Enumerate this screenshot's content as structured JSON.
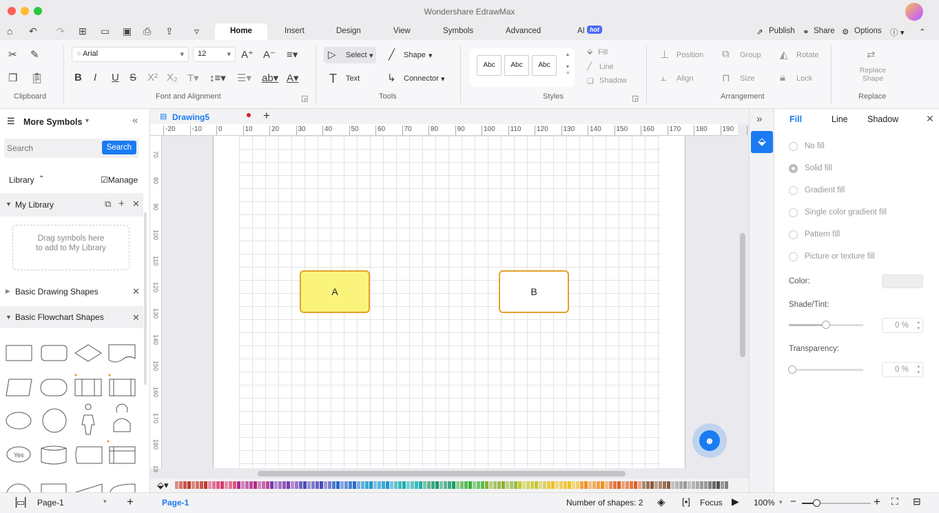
{
  "app": {
    "title": "Wondershare EdrawMax"
  },
  "menu": {
    "tabs": [
      "Home",
      "Insert",
      "Design",
      "View",
      "Symbols",
      "Advanced",
      "AI"
    ],
    "ai_badge": "hot",
    "publish": "Publish",
    "share": "Share",
    "options": "Options"
  },
  "ribbon": {
    "font_name": "Arial",
    "font_size": "12",
    "select": "Select",
    "shape": "Shape",
    "text": "Text",
    "connector": "Connector",
    "style_samples": [
      "Abc",
      "Abc",
      "Abc"
    ],
    "fill": "Fill",
    "line": "Line",
    "shadow": "Shadow",
    "position": "Position",
    "group": "Group",
    "rotate": "Rotate",
    "align": "Align",
    "size": "Size",
    "lock": "Lock",
    "replace_shape": "Replace Shape",
    "groups": [
      "Clipboard",
      "Font and Alignment",
      "Tools",
      "Styles",
      "Arrangement",
      "Replace"
    ]
  },
  "left_panel": {
    "title": "More Symbols",
    "search_placeholder": "Search",
    "search_button": "Search",
    "library_label": "Library",
    "manage": "Manage",
    "my_library": "My Library",
    "drag_hint": "Drag symbols here to add to My Library",
    "basic_drawing": "Basic Drawing Shapes",
    "basic_flowchart": "Basic Flowchart Shapes",
    "yes_label": "Yes"
  },
  "document": {
    "tab_name": "Drawing5",
    "ruler_h": [
      "-20",
      "-10",
      "0",
      "10",
      "20",
      "30",
      "40",
      "50",
      "60",
      "70",
      "80",
      "90",
      "100",
      "110",
      "120",
      "130",
      "140",
      "150",
      "160",
      "170",
      "180",
      "190",
      "2"
    ],
    "ruler_v": [
      "70",
      "80",
      "90",
      "100",
      "110",
      "120",
      "130",
      "140",
      "150",
      "160",
      "170",
      "180",
      "19"
    ],
    "shape_a": "A",
    "shape_b": "B"
  },
  "right_panel": {
    "tabs": [
      "Fill",
      "Line",
      "Shadow"
    ],
    "options": [
      "No fill",
      "Solid fill",
      "Gradient fill",
      "Single color gradient fill",
      "Pattern fill",
      "Picture or texture fill"
    ],
    "color_label": "Color:",
    "shade_label": "Shade/Tint:",
    "shade_value": "0 %",
    "transparency_label": "Transparency:",
    "transparency_value": "0 %"
  },
  "status": {
    "page_select": "Page-1",
    "page_tab": "Page-1",
    "shape_count": "Number of shapes: 2",
    "focus": "Focus",
    "zoom": "100%"
  },
  "colors": {
    "accent": "#1a7bf2",
    "shape_a_fill": "#fbf47c",
    "shape_border": "#e0a22a"
  }
}
